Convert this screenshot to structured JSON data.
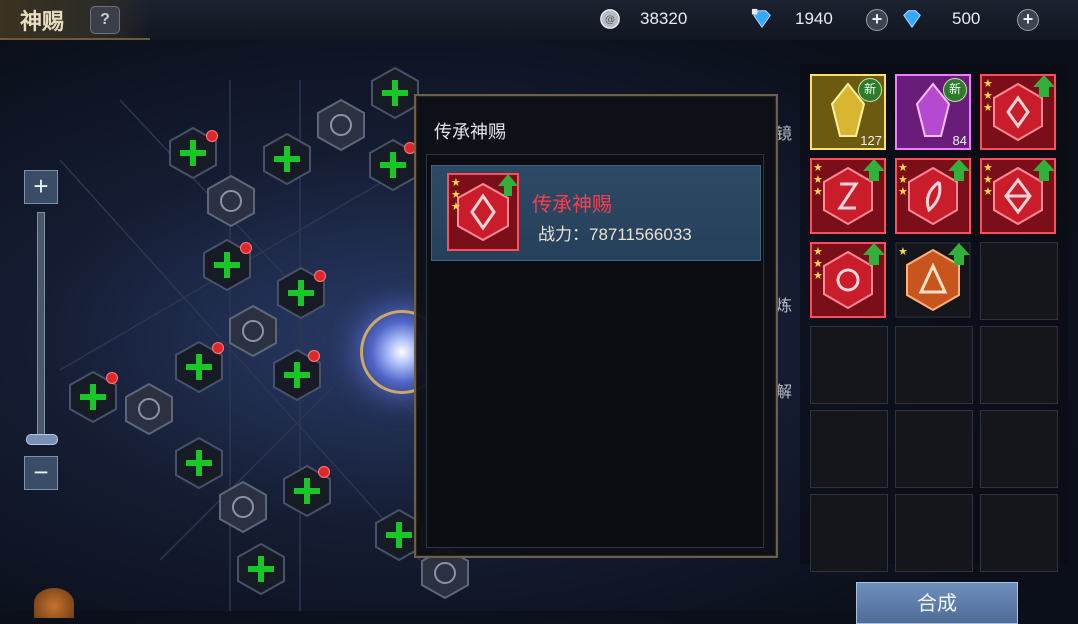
{
  "header": {
    "title": "神赐",
    "help_label": "?",
    "silver_value": "38320",
    "diamond_bound_value": "1940",
    "diamond_value": "500",
    "plus_label": "+"
  },
  "zoom": {
    "plus_label": "+",
    "minus_label": "−"
  },
  "popup": {
    "title": "传承神赐",
    "entry": {
      "name": "传承神赐",
      "power": "战力：78711566033"
    }
  },
  "sidebar_tabs": [
    "镜",
    "炼",
    "解"
  ],
  "inventory": {
    "items": [
      {
        "type": "crystal-gold",
        "new_badge": "新",
        "count": "127"
      },
      {
        "type": "crystal-purple",
        "new_badge": "新",
        "count": "84"
      },
      {
        "type": "red-emblem"
      },
      {
        "type": "red-emblem"
      },
      {
        "type": "red-emblem"
      },
      {
        "type": "red-emblem"
      },
      {
        "type": "red-emblem"
      },
      {
        "type": "orange-emblem"
      }
    ]
  },
  "craft_button": "合成",
  "colors": {
    "accent_gold": "#c8a96a",
    "red_name": "#ff3b4a",
    "plus_green": "#18c628"
  }
}
